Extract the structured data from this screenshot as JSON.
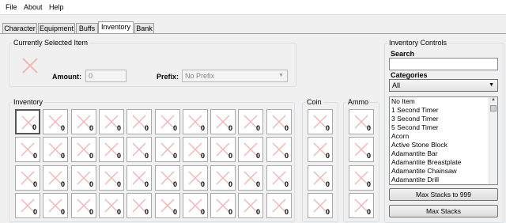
{
  "menu": [
    "File",
    "About",
    "Help"
  ],
  "tabs": [
    "Character",
    "Equipment",
    "Buffs",
    "Inventory",
    "Bank"
  ],
  "active_tab": "Inventory",
  "selected_item": {
    "legend": "Currently Selected Item",
    "amount_label": "Amount:",
    "amount_value": "0",
    "prefix_label": "Prefix:",
    "prefix_value": "No Prefix"
  },
  "inventory": {
    "legend": "Inventory",
    "rows": 4,
    "cols": 10,
    "slot_count": "0"
  },
  "coin": {
    "legend": "Coin",
    "slots": 4,
    "slot_count": "0"
  },
  "ammo": {
    "legend": "Ammo",
    "slots": 4,
    "slot_count": "0"
  },
  "controls": {
    "legend": "Inventory Controls",
    "search_label": "Search",
    "search_value": "",
    "categories_label": "Categories",
    "category_selected": "All",
    "items": [
      "No Item",
      "1 Second Timer",
      "3 Second Timer",
      "5 Second Timer",
      "Acorn",
      "Active Stone Block",
      "Adamantite Bar",
      "Adamantite Breastplate",
      "Adamantite Chainsaw",
      "Adamantite Drill"
    ],
    "max999_label": "Max Stacks to 999",
    "max_label": "Max Stacks"
  },
  "colors": {
    "empty_slot_x": "#f0b8b8",
    "group_border": "#d5dfe5"
  }
}
